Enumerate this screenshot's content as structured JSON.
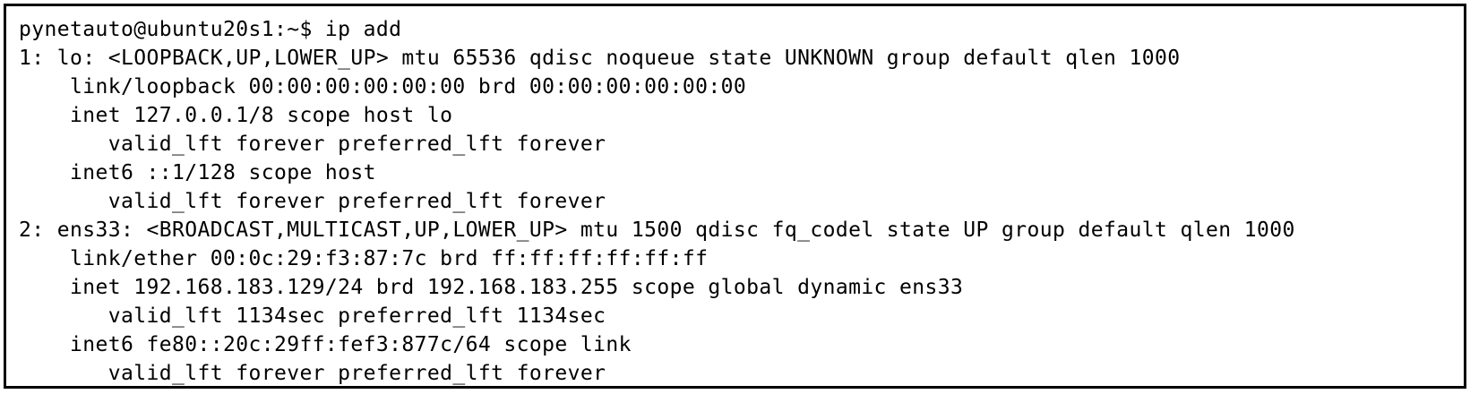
{
  "terminal": {
    "prompt": "pynetauto@ubuntu20s1:~$ ip add",
    "lines": [
      "1: lo: <LOOPBACK,UP,LOWER_UP> mtu 65536 qdisc noqueue state UNKNOWN group default qlen 1000",
      "    link/loopback 00:00:00:00:00:00 brd 00:00:00:00:00:00",
      "    inet 127.0.0.1/8 scope host lo",
      "       valid_lft forever preferred_lft forever",
      "    inet6 ::1/128 scope host",
      "       valid_lft forever preferred_lft forever",
      "2: ens33: <BROADCAST,MULTICAST,UP,LOWER_UP> mtu 1500 qdisc fq_codel state UP group default qlen 1000",
      "    link/ether 00:0c:29:f3:87:7c brd ff:ff:ff:ff:ff:ff",
      "    inet 192.168.183.129/24 brd 192.168.183.255 scope global dynamic ens33",
      "       valid_lft 1134sec preferred_lft 1134sec",
      "    inet6 fe80::20c:29ff:fef3:877c/64 scope link",
      "       valid_lft forever preferred_lft forever"
    ]
  }
}
